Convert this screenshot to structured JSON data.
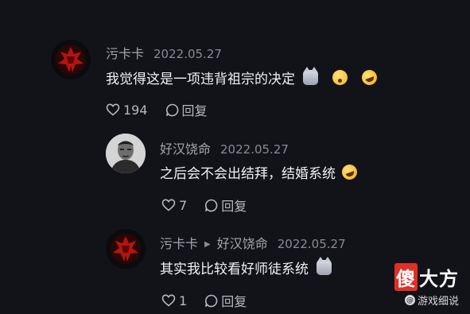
{
  "comments": [
    {
      "user": "污卡卡",
      "date": "2022.05.27",
      "text": "我觉得这是一项违背祖宗的决定",
      "emojis": [
        "cat-emoji",
        "surprised-emoji",
        "laughing-emoji"
      ],
      "likes": "194",
      "reply_label": "回复",
      "avatar": "horde-emblem-icon"
    },
    {
      "user": "好汉饶命",
      "date": "2022.05.27",
      "text": "之后会不会出结拜，结婚系统",
      "emojis": [
        "laughing-emoji"
      ],
      "likes": "7",
      "reply_label": "回复",
      "avatar": "man-portrait-avatar"
    },
    {
      "user": "污卡卡",
      "reply_to": "好汉饶命",
      "date": "2022.05.27",
      "text": "其实我比较看好师徒系统",
      "emojis": [
        "cat-emoji"
      ],
      "likes": "1",
      "reply_label": "回复",
      "avatar": "horde-emblem-icon"
    }
  ],
  "watermark": {
    "logo_first": "傻",
    "logo_rest": "大方",
    "sub_icon": "@",
    "sub": "游戏细说"
  },
  "colors": {
    "background": "#121318",
    "username": "#a5a5ad",
    "text": "#f0f0f4",
    "watermark_accent": "#e02f27"
  }
}
